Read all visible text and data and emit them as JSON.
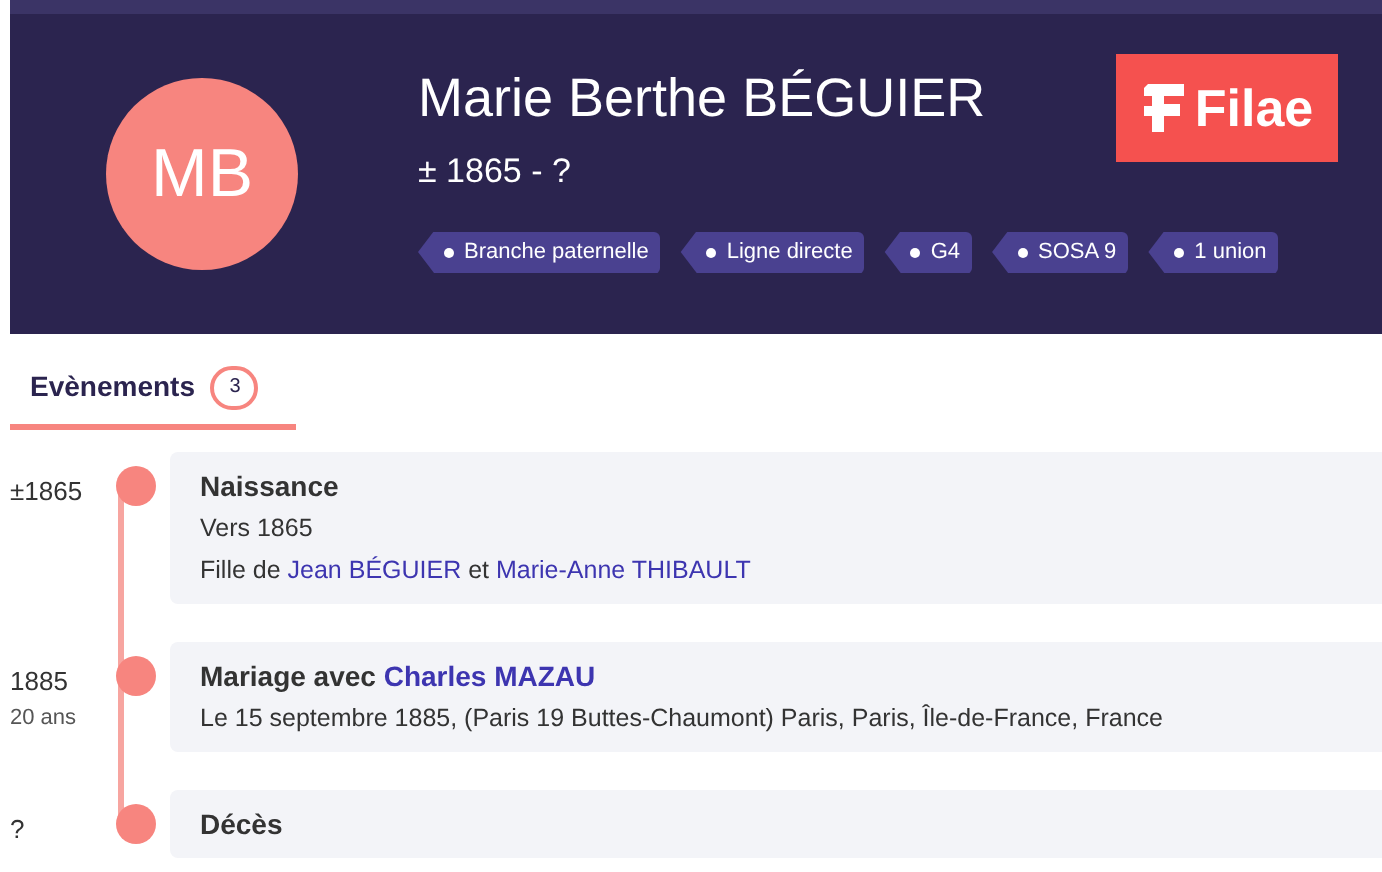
{
  "profile": {
    "initials": "MB",
    "name": "Marie Berthe BÉGUIER",
    "lifespan": "± 1865 - ?",
    "logo": "Filae",
    "tags": [
      "Branche paternelle",
      "Ligne directe",
      "G4",
      "SOSA 9",
      "1 union"
    ]
  },
  "tabs": [
    {
      "label": "Evènements",
      "count": "3",
      "selected": true
    }
  ],
  "events": [
    {
      "date": "±1865",
      "title": [
        {
          "kind": "text",
          "text": "Naissance"
        }
      ],
      "lines": [
        [
          {
            "kind": "text",
            "text": "Vers 1865"
          }
        ],
        [
          {
            "kind": "text",
            "text": "Fille de "
          },
          {
            "kind": "link",
            "text": "Jean BÉGUIER"
          },
          {
            "kind": "text",
            "text": " et "
          },
          {
            "kind": "link",
            "text": "Marie-Anne THIBAULT"
          }
        ]
      ]
    },
    {
      "date": "1885",
      "age": "20 ans",
      "title": [
        {
          "kind": "text",
          "text": "Mariage avec "
        },
        {
          "kind": "link",
          "text": "Charles MAZAU"
        }
      ],
      "lines": [
        [
          {
            "kind": "text",
            "text": "Le 15 septembre 1885, (Paris 19 Buttes-Chaumont) Paris, Paris, Île-de-France, France"
          }
        ]
      ]
    },
    {
      "date": "?",
      "title": [
        {
          "kind": "text",
          "text": "Décès"
        }
      ]
    }
  ]
}
